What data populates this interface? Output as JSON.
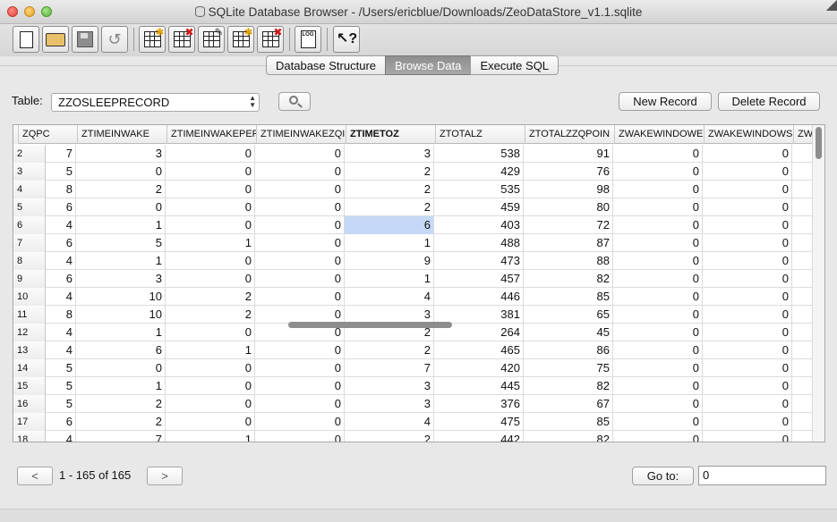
{
  "window": {
    "title": "SQLite Database Browser - /Users/ericblue/Downloads/ZeoDataStore_v1.1.sqlite"
  },
  "toolbar": {
    "buttons": [
      {
        "icon": "new-database-icon"
      },
      {
        "icon": "open-database-icon"
      },
      {
        "icon": "save-database-icon"
      },
      {
        "icon": "undo-icon"
      },
      {
        "icon": "create-table-icon"
      },
      {
        "icon": "delete-table-icon"
      },
      {
        "icon": "modify-table-icon"
      },
      {
        "icon": "create-index-icon"
      },
      {
        "icon": "delete-index-icon"
      },
      {
        "icon": "sql-log-icon",
        "label": "LOG"
      },
      {
        "icon": "whats-this-icon",
        "label": "?"
      }
    ]
  },
  "tabs": [
    {
      "label": "Database Structure",
      "active": false
    },
    {
      "label": "Browse Data",
      "active": true
    },
    {
      "label": "Execute SQL",
      "active": false
    }
  ],
  "browse": {
    "table_label": "Table:",
    "table_value": "ZZOSLEEPRECORD",
    "new_record": "New Record",
    "delete_record": "Delete Record"
  },
  "grid": {
    "columns": [
      "ZQPC",
      "ZTIMEINWAKE",
      "ZTIMEINWAKEPER",
      "ZTIMEINWAKEZQI",
      "ZTIMETOZ",
      "ZTOTALZ",
      "ZTOTALZZQPOIN",
      "ZWAKEWINDOWEI",
      "ZWAKEWINDOWSI",
      "ZWA"
    ],
    "bold_column": 4,
    "rows": [
      {
        "n": "2",
        "v": [
          "7",
          "3",
          "0",
          "0",
          "3",
          "538",
          "91",
          "0",
          "0"
        ]
      },
      {
        "n": "3",
        "v": [
          "5",
          "0",
          "0",
          "0",
          "2",
          "429",
          "76",
          "0",
          "0"
        ]
      },
      {
        "n": "4",
        "v": [
          "8",
          "2",
          "0",
          "0",
          "2",
          "535",
          "98",
          "0",
          "0"
        ]
      },
      {
        "n": "5",
        "v": [
          "6",
          "0",
          "0",
          "0",
          "2",
          "459",
          "80",
          "0",
          "0"
        ]
      },
      {
        "n": "6",
        "v": [
          "4",
          "1",
          "0",
          "0",
          "6",
          "403",
          "72",
          "0",
          "0"
        ]
      },
      {
        "n": "7",
        "v": [
          "6",
          "5",
          "1",
          "0",
          "1",
          "488",
          "87",
          "0",
          "0"
        ]
      },
      {
        "n": "8",
        "v": [
          "4",
          "1",
          "0",
          "0",
          "9",
          "473",
          "88",
          "0",
          "0"
        ]
      },
      {
        "n": "9",
        "v": [
          "6",
          "3",
          "0",
          "0",
          "1",
          "457",
          "82",
          "0",
          "0"
        ]
      },
      {
        "n": "10",
        "v": [
          "4",
          "10",
          "2",
          "0",
          "4",
          "446",
          "85",
          "0",
          "0"
        ]
      },
      {
        "n": "11",
        "v": [
          "8",
          "10",
          "2",
          "0",
          "3",
          "381",
          "65",
          "0",
          "0"
        ]
      },
      {
        "n": "12",
        "v": [
          "4",
          "1",
          "0",
          "0",
          "2",
          "264",
          "45",
          "0",
          "0"
        ]
      },
      {
        "n": "13",
        "v": [
          "4",
          "6",
          "1",
          "0",
          "2",
          "465",
          "86",
          "0",
          "0"
        ]
      },
      {
        "n": "14",
        "v": [
          "5",
          "0",
          "0",
          "0",
          "7",
          "420",
          "75",
          "0",
          "0"
        ]
      },
      {
        "n": "15",
        "v": [
          "5",
          "1",
          "0",
          "0",
          "3",
          "445",
          "82",
          "0",
          "0"
        ]
      },
      {
        "n": "16",
        "v": [
          "5",
          "2",
          "0",
          "0",
          "3",
          "376",
          "67",
          "0",
          "0"
        ]
      },
      {
        "n": "17",
        "v": [
          "6",
          "2",
          "0",
          "0",
          "4",
          "475",
          "85",
          "0",
          "0"
        ]
      },
      {
        "n": "18",
        "v": [
          "4",
          "7",
          "1",
          "0",
          "2",
          "442",
          "82",
          "0",
          "0"
        ]
      }
    ],
    "selected": {
      "row": 4,
      "col": 4
    },
    "selection_color": "#c5d8f7"
  },
  "navigation": {
    "prev": "<",
    "range": "1 - 165 of 165",
    "next": ">",
    "goto_label": "Go to:",
    "goto_value": "0"
  }
}
